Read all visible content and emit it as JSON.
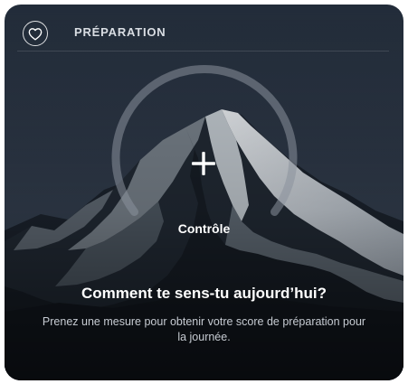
{
  "header": {
    "title": "PRÉPARATION",
    "heart_icon": "heart-icon"
  },
  "ring": {
    "action_icon": "plus-icon",
    "label": "Contrôle"
  },
  "prompt": {
    "question": "Comment te sens-tu aujourd’hui?",
    "description": "Prenez une mesure pour obtenir votre score de préparation pour la journée."
  },
  "colors": {
    "sky_top": "#222c39",
    "sky_mid": "#323d4c",
    "mountain_shadow": "#161c24",
    "snow": "#e6e9ed",
    "ring": "#8a929c"
  }
}
